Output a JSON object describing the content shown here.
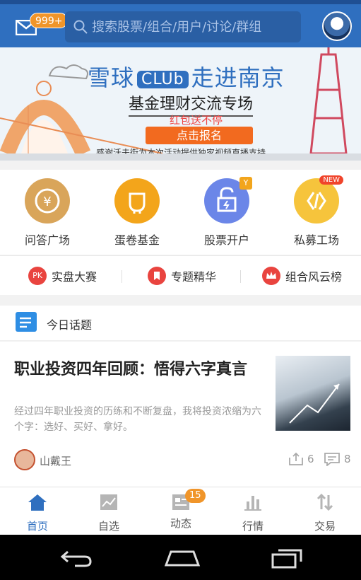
{
  "header": {
    "mail_badge": "999+",
    "search_placeholder": "搜索股票/组合/用户/讨论/群组"
  },
  "banner": {
    "title_pre": "雪球",
    "title_club": "CLUb",
    "title_post": "走进南京",
    "subtitle": "基金理财交流专场",
    "red_note": "红包送不停",
    "button": "点击报名",
    "footer": "感谢沃夫街为本次活动提供独家视频直播支持"
  },
  "quick_entries": [
    {
      "label": "问答广场",
      "icon": "yen-icon",
      "color": "#d9a55a"
    },
    {
      "label": "蛋卷基金",
      "icon": "egg-roll-icon",
      "color": "#f3a51b"
    },
    {
      "label": "股票开户",
      "icon": "unlock-icon",
      "color": "#6b86e8",
      "badge": "Y"
    },
    {
      "label": "私募工场",
      "icon": "private-fund-icon",
      "color": "#f6c43c",
      "badge": "NEW"
    }
  ],
  "sub_links": [
    {
      "label": "实盘大赛",
      "icon_text": "PK"
    },
    {
      "label": "专题精华",
      "icon_text": ""
    },
    {
      "label": "组合风云榜",
      "icon_text": ""
    }
  ],
  "topic": {
    "section_title": "今日话题"
  },
  "article": {
    "title": "职业投资四年回顾：悟得六字真言",
    "summary": "经过四年职业投资的历练和不断复盘，我将投资浓缩为六个字：选好、买好、拿好。",
    "author": "山戴王",
    "shares": "6",
    "comments": "8"
  },
  "tabs": [
    {
      "label": "首页",
      "active": true
    },
    {
      "label": "自选",
      "active": false
    },
    {
      "label": "动态",
      "active": false,
      "badge": "15"
    },
    {
      "label": "行情",
      "active": false
    },
    {
      "label": "交易",
      "active": false
    }
  ],
  "colors": {
    "brand_blue": "#2f6fbf",
    "badge_orange": "#f0952a",
    "link_red": "#e9443f"
  }
}
